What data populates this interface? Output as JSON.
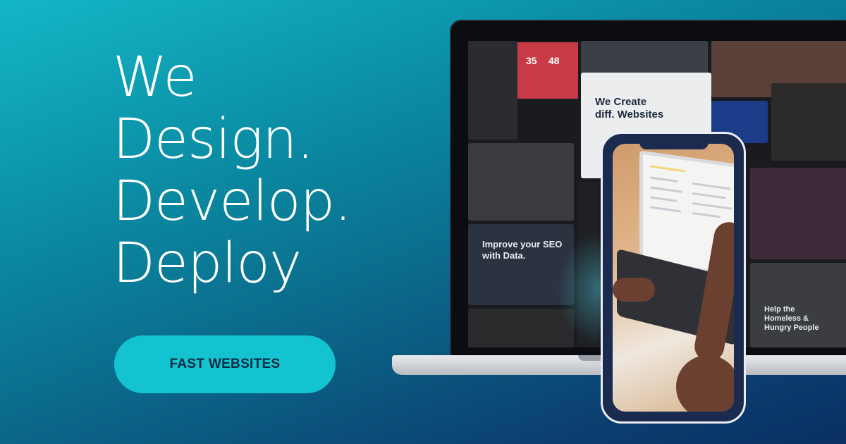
{
  "headline": {
    "line1": "We",
    "line2": "Design.",
    "line3": "Develop.",
    "line4": "Deploy"
  },
  "cta": {
    "label": "FAST WEBSITES"
  },
  "laptop_screen_texts": {
    "we_create_line1": "We Create",
    "we_create_line2": "diff. Websites",
    "seo_line1": "Improve your SEO",
    "seo_line2": "with Data.",
    "help_line1": "Help the",
    "help_line2": "Homeless &",
    "help_line3": "Hungry People",
    "counter_1": "35",
    "counter_2": "48"
  },
  "colors": {
    "background_start": "#14b7c6",
    "background_end": "#0a2f63",
    "cta_background": "#13c3cf",
    "cta_text": "#082a44"
  }
}
